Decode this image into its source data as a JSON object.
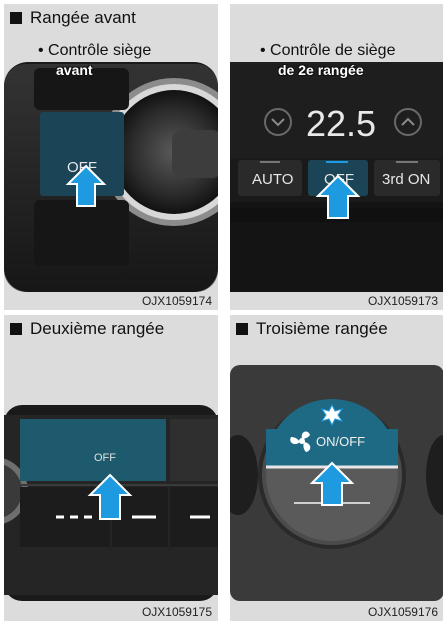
{
  "panel_front": {
    "heading": "Rangée avant",
    "subheading": "• Contrôle siège",
    "subheading_cont": "avant",
    "button_label": "OFF",
    "code": "OJX1059174"
  },
  "panel_rear_control": {
    "subheading": "• Contrôle de siège",
    "subheading_cont": "de 2e rangée",
    "temperature": "22.5",
    "buttons": [
      "AUTO",
      "OFF",
      "3rd ON"
    ],
    "code": "OJX1059173"
  },
  "panel_second_row": {
    "heading": "Deuxième rangée",
    "button_label": "OFF",
    "code": "OJX1059175"
  },
  "panel_third_row": {
    "heading": "Troisième rangée",
    "button_label": "ON/OFF",
    "code": "OJX1059176"
  },
  "colors": {
    "highlight_blue": "#1e9be0",
    "button_teal": "#1f5d72",
    "panel_dark": "#1c1c1c"
  }
}
